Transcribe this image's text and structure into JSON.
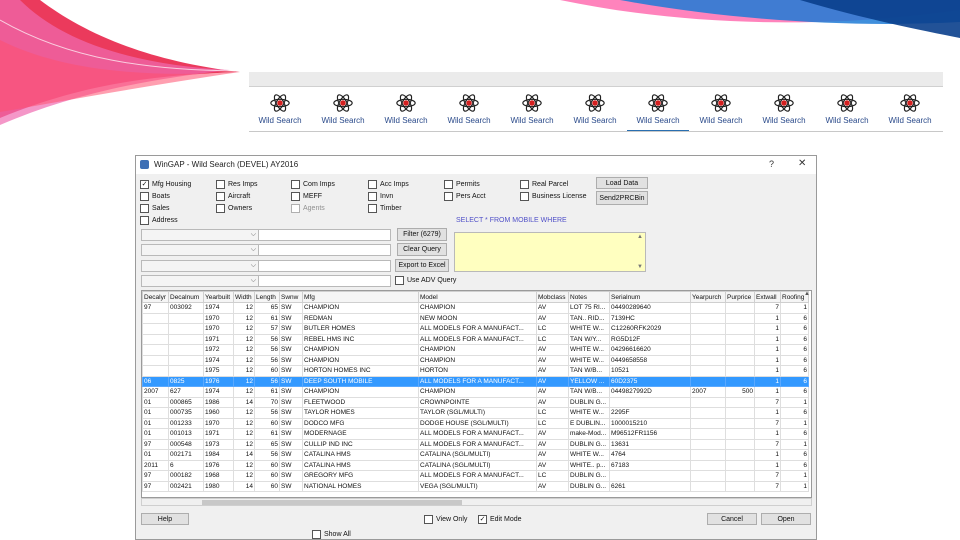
{
  "colors": {
    "swoosh_red": "#e8173f",
    "swoosh_pink": "#f06bb0",
    "swoosh_blue": "#1e7bd6",
    "selected_row": "#3399ff",
    "sql_box": "#ffffc0",
    "sql_label": "#5050c8"
  },
  "tabs": [
    {
      "label": "Wild Search"
    },
    {
      "label": "Wild Search"
    },
    {
      "label": "Wild Search"
    },
    {
      "label": "Wild Search"
    },
    {
      "label": "Wild Search"
    },
    {
      "label": "Wild Search"
    },
    {
      "label": "Wild Search",
      "active": true
    },
    {
      "label": "Wild Search"
    },
    {
      "label": "Wild Search"
    },
    {
      "label": "Wild Search"
    },
    {
      "label": "Wild Search"
    }
  ],
  "dialog": {
    "title": "WinGAP - Wild Search (DEVEL) AY2016",
    "help_glyph": "?",
    "close_glyph": "✕",
    "checkboxes": {
      "mfg_housing": {
        "label": "Mfg Housing",
        "checked": true
      },
      "boats": {
        "label": "Boats"
      },
      "sales": {
        "label": "Sales"
      },
      "address": {
        "label": "Address"
      },
      "res_imps": {
        "label": "Res Imps"
      },
      "aircraft": {
        "label": "Aircraft"
      },
      "owners": {
        "label": "Owners"
      },
      "com_imps": {
        "label": "Com Imps"
      },
      "meff": {
        "label": "MEFF"
      },
      "agents": {
        "label": "Agents",
        "disabled": true
      },
      "acc_imps": {
        "label": "Acc Imps"
      },
      "invn": {
        "label": "Invn"
      },
      "timber": {
        "label": "Timber"
      },
      "permits": {
        "label": "Permits"
      },
      "pers_acct": {
        "label": "Pers Acct"
      },
      "real_parcel": {
        "label": "Real Parcel"
      },
      "business_license": {
        "label": "Business License"
      },
      "use_adv_query": {
        "label": "Use ADV Query"
      }
    },
    "buttons": {
      "load_data": "Load Data",
      "send2prcbin": "Send2PRCBin",
      "filter": "Filter (6279)",
      "clear_query": "Clear Query",
      "export_excel": "Export to Excel",
      "help": "Help",
      "cancel": "Cancel",
      "open": "Open"
    },
    "sql_text": "SELECT * FROM MOBILE WHERE",
    "bottom_checks": {
      "view_only": {
        "label": "View Only"
      },
      "edit_mode": {
        "label": "Edit Mode",
        "checked": true
      },
      "show_all": {
        "label": "Show All"
      }
    }
  },
  "grid": {
    "columns": [
      "Decalyr",
      "Decalnum",
      "Yearbuilt",
      "Width",
      "Length",
      "Swnw",
      "Mfg",
      "Model",
      "Mobclass",
      "Notes",
      "Serialnum",
      "Yearpurch",
      "Purprice",
      "Extwall",
      "Roofing"
    ],
    "rows": [
      [
        "97",
        "003092",
        "1974",
        "12",
        "65",
        "SW",
        "CHAMPION",
        "CHAMPION",
        "AV",
        "LOT 75 RI...",
        "04490289640",
        "",
        "",
        "7",
        "1"
      ],
      [
        "",
        "",
        "1970",
        "12",
        "61",
        "SW",
        "REDMAN",
        "NEW MOON",
        "AV",
        "TAN.. RID...",
        "7139HC",
        "",
        "",
        "1",
        "6"
      ],
      [
        "",
        "",
        "1970",
        "12",
        "57",
        "SW",
        "BUTLER HOMES",
        " ALL MODELS FOR A MANUFACT...",
        "LC",
        "WHITE W...",
        "C12260RFK2029",
        "",
        "",
        "1",
        "6"
      ],
      [
        "",
        "",
        "1971",
        "12",
        "56",
        "SW",
        "REBEL HMS INC",
        " ALL MODELS FOR A MANUFACT...",
        "LC",
        "TAN W/Y...",
        "RG5D12F",
        "",
        "",
        "1",
        "6"
      ],
      [
        "",
        "",
        "1972",
        "12",
        "56",
        "SW",
        "CHAMPION",
        "CHAMPION",
        "AV",
        "WHITE W...",
        "04296616620",
        "",
        "",
        "1",
        "6"
      ],
      [
        "",
        "",
        "1974",
        "12",
        "56",
        "SW",
        "CHAMPION",
        "CHAMPION",
        "AV",
        "WHITE W...",
        "0449658558",
        "",
        "",
        "1",
        "6"
      ],
      [
        "",
        "",
        "1975",
        "12",
        "60",
        "SW",
        "HORTON HOMES INC",
        "HORTON",
        "AV",
        "TAN W/B...",
        "10521",
        "",
        "",
        "1",
        "6"
      ],
      [
        "06",
        "0825",
        "1976",
        "12",
        "56",
        "SW",
        "DEEP SOUTH MOBILE",
        " ALL MODELS FOR A MANUFACT...",
        "AV",
        "YELLOW ...",
        "60D2375",
        "",
        "",
        "1",
        "6"
      ],
      [
        "2007",
        "627",
        "1974",
        "12",
        "61",
        "SW",
        "CHAMPION",
        "CHAMPION",
        "AV",
        "TAN W/B...",
        "0449827992D",
        "2007",
        "500",
        "1",
        "6"
      ],
      [
        "01",
        "000865",
        "1986",
        "14",
        "70",
        "SW",
        "FLEETWOOD",
        "CROWNPOINTE",
        "AV",
        "DUBLIN G...",
        "",
        "",
        "",
        "7",
        "1"
      ],
      [
        "01",
        "000735",
        "1960",
        "12",
        "56",
        "SW",
        "TAYLOR HOMES",
        "TAYLOR (SGL/MULTI)",
        "LC",
        "WHITE W...",
        "2295F",
        "",
        "",
        "1",
        "6"
      ],
      [
        "01",
        "001233",
        "1970",
        "12",
        "60",
        "SW",
        "DODCO MFG",
        "DODGE HOUSE (SGL/MULTI)",
        "LC",
        "E DUBLIN...",
        "1000015210",
        "",
        "",
        "7",
        "1"
      ],
      [
        "01",
        "001013",
        "1971",
        "12",
        "61",
        "SW",
        "MODERNAGE",
        " ALL MODELS FOR A MANUFACT...",
        "AV",
        "make-Mod...",
        "M96512FR1156",
        "",
        "",
        "1",
        "6"
      ],
      [
        "97",
        "000548",
        "1973",
        "12",
        "65",
        "SW",
        "CULLIP IND INC",
        " ALL MODELS FOR A MANUFACT...",
        "AV",
        "DUBLIN G...",
        "13631",
        "",
        "",
        "7",
        "1"
      ],
      [
        "01",
        "002171",
        "1984",
        "14",
        "56",
        "SW",
        "CATALINA HMS",
        "CATALINA (SGL/MULTI)",
        "AV",
        "WHITE W...",
        "4764",
        "",
        "",
        "1",
        "6"
      ],
      [
        "2011",
        "6",
        "1976",
        "12",
        "60",
        "SW",
        "CATALINA HMS",
        "CATALINA (SGL/MULTI)",
        "AV",
        "WHITE.. p...",
        "67183",
        "",
        "",
        "1",
        "6"
      ],
      [
        "97",
        "000182",
        "1968",
        "12",
        "60",
        "SW",
        "GREGORY MFG",
        " ALL MODELS FOR A MANUFACT...",
        "LC",
        "DUBLIN G...",
        "",
        "",
        "",
        "7",
        "1"
      ],
      [
        "97",
        "002421",
        "1980",
        "14",
        "60",
        "SW",
        "NATIONAL HOMES",
        "VEGA (SGL/MULTI)",
        "AV",
        "DUBLIN G...",
        "6261",
        "",
        "",
        "7",
        "1"
      ]
    ],
    "selected_row": 7
  }
}
